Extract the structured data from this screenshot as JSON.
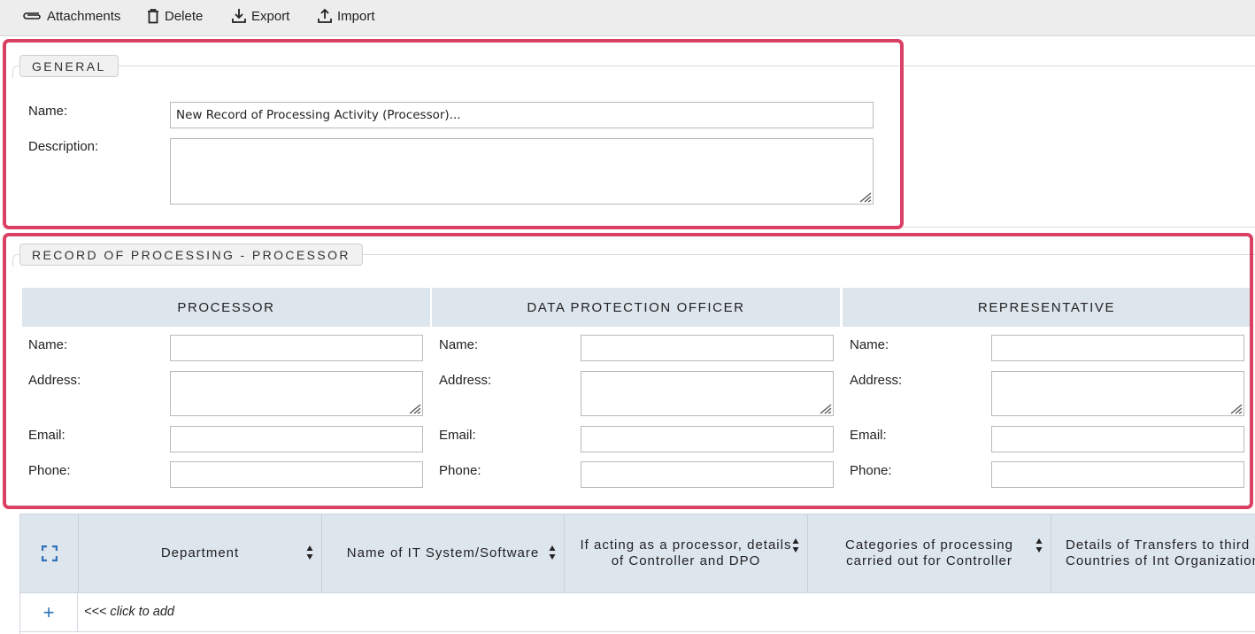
{
  "toolbar": {
    "attachments": "Attachments",
    "delete": "Delete",
    "export": "Export",
    "import": "Import"
  },
  "general": {
    "legend": "GENERAL",
    "name_label": "Name:",
    "name_value": "New Record of Processing Activity (Processor)...",
    "description_label": "Description:",
    "description_value": ""
  },
  "record": {
    "legend": "RECORD OF PROCESSING - PROCESSOR",
    "columns": [
      {
        "title": "PROCESSOR",
        "name_label": "Name:",
        "address_label": "Address:",
        "email_label": "Email:",
        "phone_label": "Phone:"
      },
      {
        "title": "DATA PROTECTION OFFICER",
        "name_label": "Name:",
        "address_label": "Address:",
        "email_label": "Email:",
        "phone_label": "Phone:"
      },
      {
        "title": "REPRESENTATIVE",
        "name_label": "Name:",
        "address_label": "Address:",
        "email_label": "Email:",
        "phone_label": "Phone:"
      }
    ]
  },
  "table": {
    "headers": [
      "Department",
      "Name of IT System/Software",
      "If acting as a processor, details of Controller and DPO",
      "Categories of processing carried out for Controller",
      "Details of Transfers to third Countries of Int Organization"
    ],
    "add_symbol": "+",
    "add_hint": "<<< click to add"
  },
  "colors": {
    "highlight": "#d94063",
    "header_bg": "#dde5ed",
    "accent": "#2f72b8"
  }
}
